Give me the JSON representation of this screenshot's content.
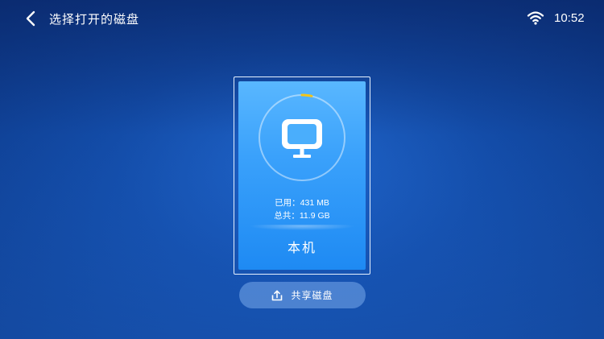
{
  "header": {
    "title": "选择打开的磁盘",
    "back_icon": "chevron-left-icon",
    "wifi_icon": "wifi-icon",
    "time": "10:52"
  },
  "disk": {
    "icon": "monitor-icon",
    "used_label": "已用：431 MB",
    "total_label": "总共：11.9 GB",
    "name": "本机",
    "usage_fraction": 0.036,
    "ring_color": "#f5c518"
  },
  "share": {
    "icon": "upload-share-icon",
    "label": "共享磁盘"
  }
}
